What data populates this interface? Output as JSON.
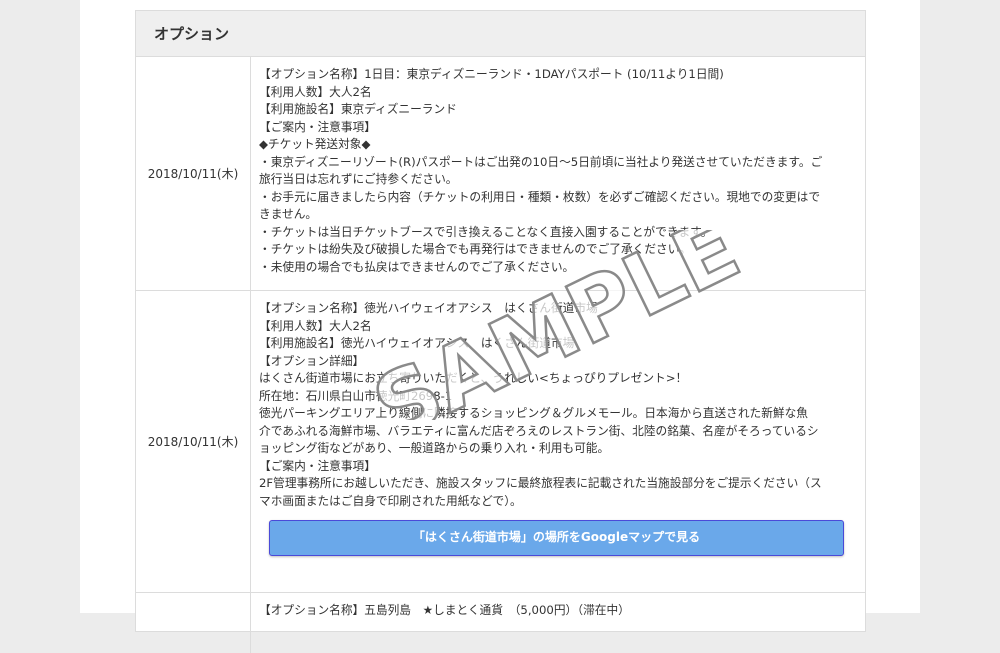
{
  "header": {
    "title": "オプション"
  },
  "options": [
    {
      "date": "2018/10/11(木)",
      "lines": [
        "【オプション名称】1日目：東京ディズニーランド・1DAYパスポート (10/11より1日間)",
        "【利用人数】大人2名",
        "【利用施設名】東京ディズニーランド",
        "【ご案内・注意事項】",
        "◆チケット発送対象◆",
        "・東京ディズニーリゾート(R)パスポートはご出発の10日～5日前頃に当社より発送させていただきます。ご",
        "旅行当日は忘れずにご持参ください。",
        "・お手元に届きましたら内容（チケットの利用日・種類・枚数）を必ずご確認ください。現地での変更はで",
        "きません。",
        "・チケットは当日チケットブースで引き換えることなく直接入園することができます。",
        "・チケットは紛失及び破損した場合でも再発行はできませんのでご了承ください。",
        "・未使用の場合でも払戻はできませんのでご了承ください。"
      ]
    },
    {
      "date": "2018/10/11(木)",
      "lines": [
        "【オプション名称】徳光ハイウェイオアシス　はくさん街道市場",
        "【利用人数】大人2名",
        "【利用施設名】徳光ハイウェイオアシス　はくさん街道市場",
        "【オプション詳細】",
        "はくさん街道市場にお立ち寄りいただくと、うれしい<ちょっぴりプレゼント>！",
        "所在地：石川県白山市徳光町2698-1",
        "徳光パーキングエリア上り線側に隣接するショッピング＆グルメモール。日本海から直送された新鮮な魚",
        "介であふれる海鮮市場、バラエティに富んだ店ぞろえのレストラン街、北陸の銘菓、名産がそろっているシ",
        "ョッピング街などがあり、一般道路からの乗り入れ・利用も可能。",
        "【ご案内・注意事項】",
        "2F管理事務所にお越しいただき、施設スタッフに最終旅程表に記載された当施設部分をご提示ください（ス",
        "マホ画面またはご自身で印刷された用紙などで）。"
      ],
      "button_label": "「はくさん街道市場」の場所をGoogleマップで見る"
    },
    {
      "date": "",
      "lines": [
        "【オプション名称】五島列島　★しまとく通貨　（5,000円）（滞在中）"
      ]
    }
  ],
  "watermark": "SAMPLE",
  "colors": {
    "button_bg": "#6aa8ea",
    "button_border": "#4a4ad8",
    "header_bg": "#efefef"
  }
}
